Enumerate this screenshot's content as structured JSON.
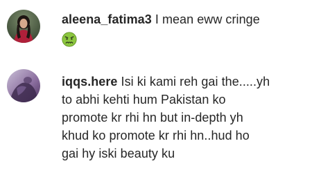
{
  "comments": [
    {
      "username": "aleena_fatima3",
      "text": "I mean eww cringe",
      "emoji": "nauseated-face-emoji",
      "avatar": "profile-photo"
    },
    {
      "username": "iqqs.here",
      "text_lines": [
        "Isi ki kami reh gai the.....yh",
        "to abhi kehti hum Pakistan ko",
        "promote kr rhi hn but in-depth yh",
        "khud ko promote kr rhi hn..hud ho",
        "gai hy iski beauty ku"
      ],
      "avatar": "profile-photo"
    }
  ],
  "colors": {
    "text": "#262626",
    "background": "#ffffff",
    "emoji_face": "#8cc63f"
  }
}
